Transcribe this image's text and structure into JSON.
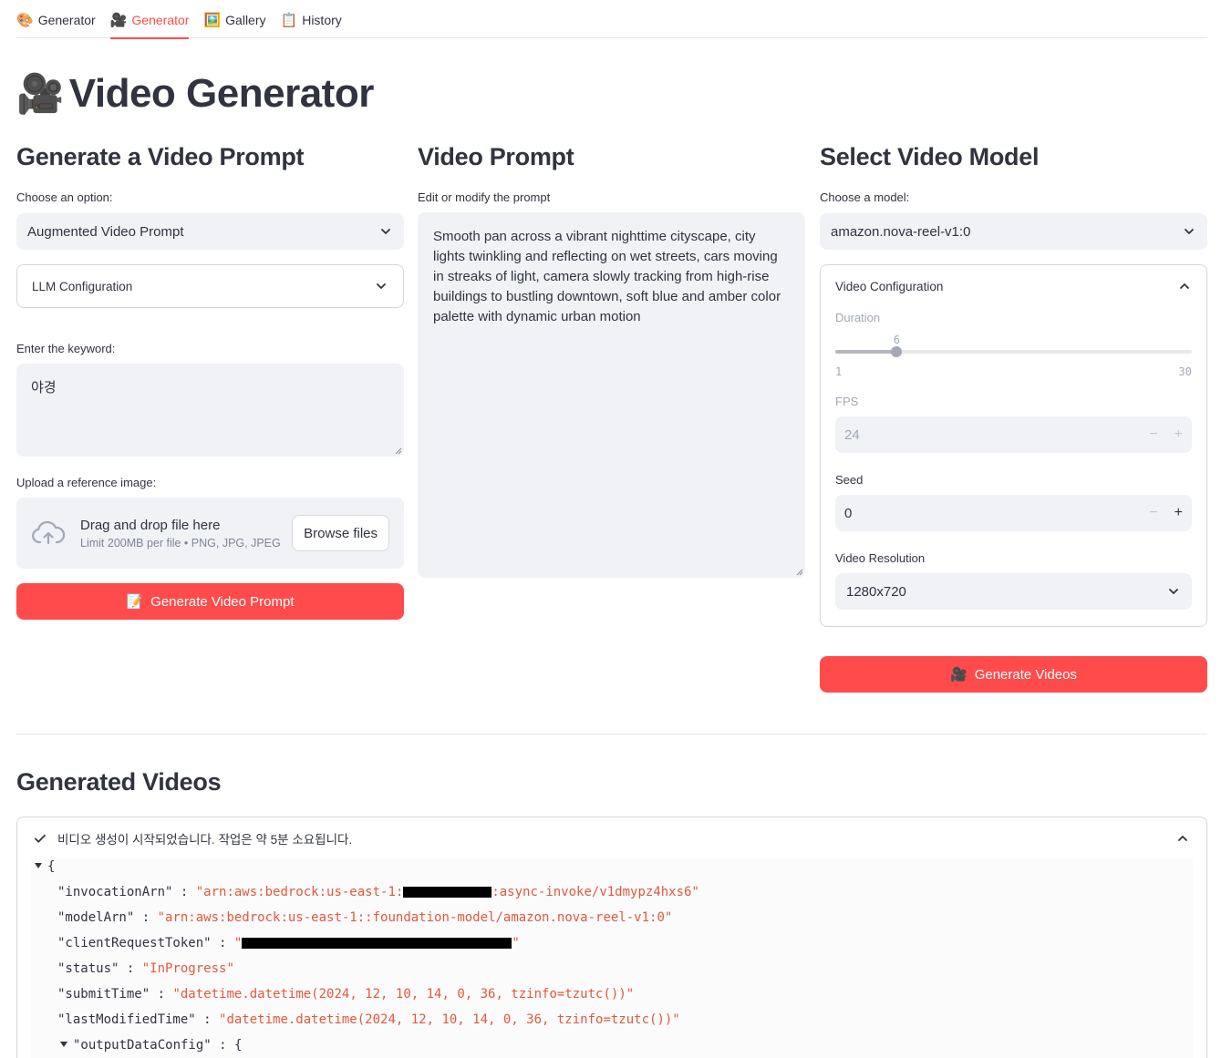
{
  "tabs": [
    {
      "icon": "🎨",
      "label": "Generator"
    },
    {
      "icon": "🎥",
      "label": "Generator"
    },
    {
      "icon": "🖼️",
      "label": "Gallery"
    },
    {
      "icon": "📋",
      "label": "History"
    }
  ],
  "page": {
    "icon": "🎥",
    "title": "Video Generator"
  },
  "prompt_gen": {
    "heading": "Generate a Video Prompt",
    "option_label": "Choose an option:",
    "option_value": "Augmented Video Prompt",
    "llm_expander": "LLM Configuration",
    "keyword_label": "Enter the keyword:",
    "keyword_value": "야경",
    "upload_label": "Upload a reference image:",
    "upload_main": "Drag and drop file here",
    "upload_sub": "Limit 200MB per file • PNG, JPG, JPEG",
    "browse": "Browse files",
    "button_icon": "📝",
    "button": "Generate Video Prompt"
  },
  "video_prompt": {
    "heading": "Video Prompt",
    "label": "Edit or modify the prompt",
    "text": "Smooth pan across a vibrant nighttime cityscape, city lights twinkling and reflecting on wet streets, cars moving in streaks of light, camera slowly tracking from high-rise buildings to bustling downtown, soft blue and amber color palette with dynamic urban motion"
  },
  "model": {
    "heading": "Select Video Model",
    "label": "Choose a model:",
    "value": "amazon.nova-reel-v1:0",
    "config_title": "Video Configuration",
    "duration_label": "Duration",
    "duration_value": 6,
    "duration_min": 1,
    "duration_max": 30,
    "fps_label": "FPS",
    "fps_value": "24",
    "seed_label": "Seed",
    "seed_value": "0",
    "resolution_label": "Video Resolution",
    "resolution_value": "1280x720",
    "button_icon": "🎥",
    "button": "Generate Videos"
  },
  "generated": {
    "heading": "Generated Videos",
    "status": "비디오 생성이 시작되었습니다. 작업은 약 5분 소요됩니다.",
    "json": {
      "open": "{",
      "invocationArn_key": "\"invocationArn\"",
      "invocationArn_a": "\"arn:aws:bedrock:us-east-1:",
      "invocationArn_b": ":async-invoke/v1dmypz4hxs6\"",
      "modelArn_key": "\"modelArn\"",
      "modelArn_val": "\"arn:aws:bedrock:us-east-1::foundation-model/amazon.nova-reel-v1:0\"",
      "token_key": "\"clientRequestToken\"",
      "token_a": "\"",
      "token_b": "\"",
      "status_key": "\"status\"",
      "status_val": "\"InProgress\"",
      "submit_key": "\"submitTime\"",
      "submit_val": "\"datetime.datetime(2024, 12, 10, 14, 0, 36, tzinfo=tzutc())\"",
      "modified_key": "\"lastModifiedTime\"",
      "modified_val": "\"datetime.datetime(2024, 12, 10, 14, 0, 36, tzinfo=tzutc())\"",
      "output_key": "\"outputDataConfig\"",
      "output_open": "{",
      "colon": " : "
    }
  },
  "colors": {
    "accent": "#ff4b4b",
    "input_bg": "#f0f2f6",
    "json_string": "#e2583e"
  }
}
